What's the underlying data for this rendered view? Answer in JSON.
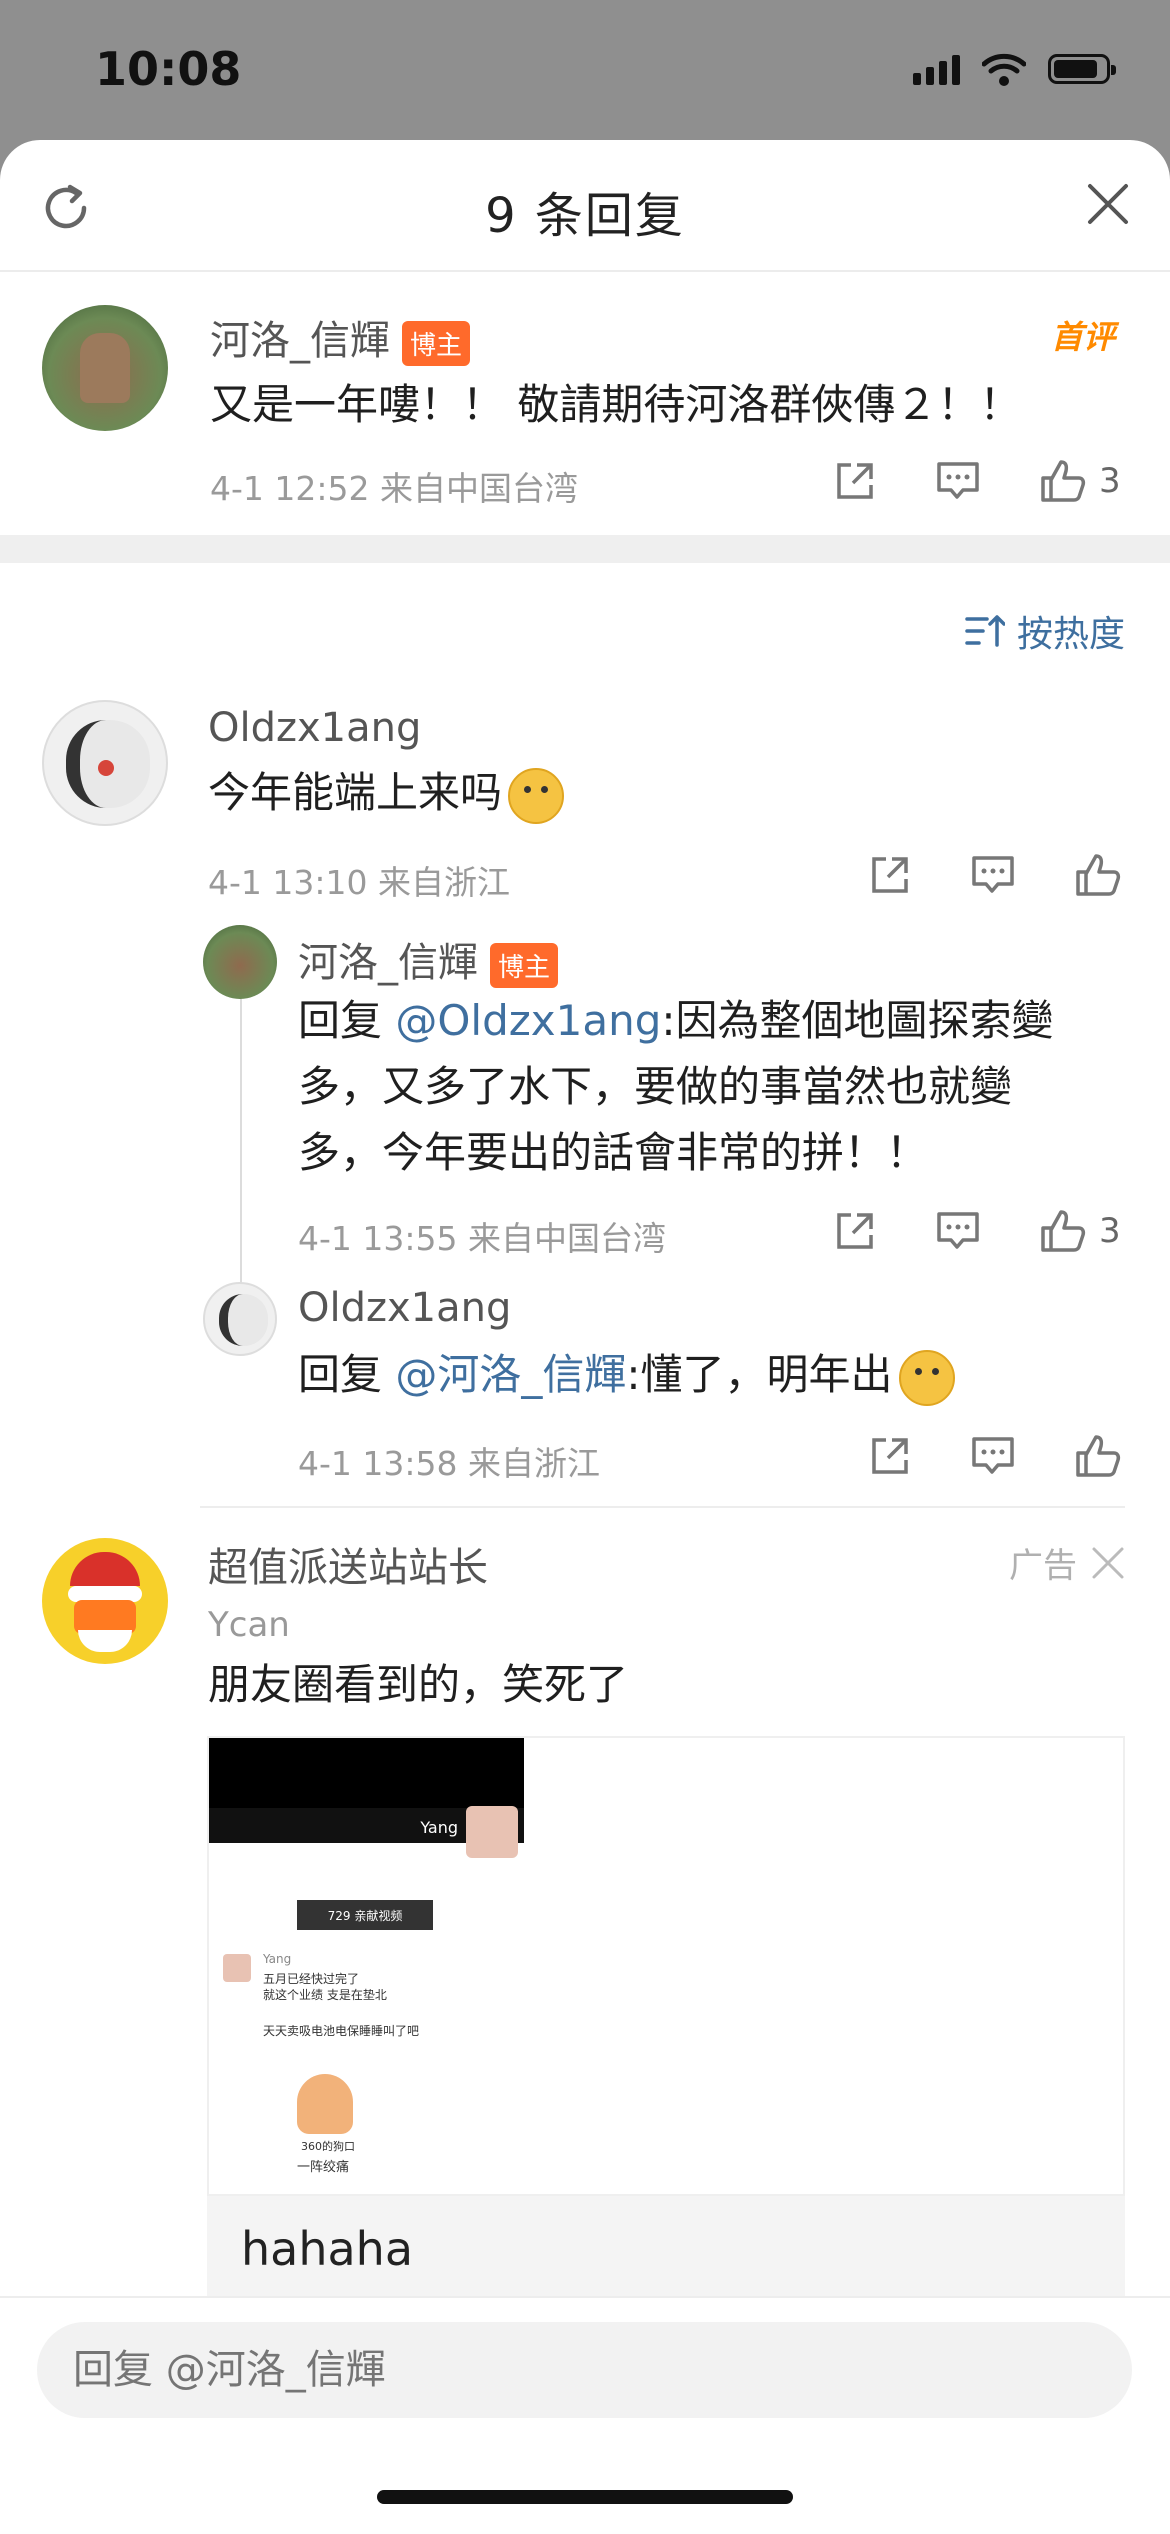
{
  "status": {
    "time": "10:08",
    "battery_level": 0.85
  },
  "header": {
    "title": "9 条回复"
  },
  "main_comment": {
    "author": "河洛_信輝",
    "badge": "博主",
    "tag": "首评",
    "text": "又是一年嘍！！ 敬請期待河洛群俠傳２！！",
    "meta": "4-1 12:52  来自中国台湾",
    "likes": "3"
  },
  "sort": {
    "label": "按热度"
  },
  "comments": [
    {
      "author": "Oldzx1ang",
      "text": "今年能端上来吗",
      "meta": "4-1 13:10  来自浙江",
      "replies": [
        {
          "author": "河洛_信輝",
          "badge": "博主",
          "prefix": "回复 ",
          "mention": "@Oldzx1ang",
          "text_line1": ":因為整個地圖探索變",
          "text_line2": "多，又多了水下，要做的事當然也就變",
          "text_line3": "多，今年要出的話會非常的拼！！",
          "meta": "4-1 13:55  来自中国台湾",
          "likes": "3"
        },
        {
          "author": "Oldzx1ang",
          "prefix": "回复 ",
          "mention": "@河洛_信輝",
          "text": ":懂了，明年出",
          "meta": "4-1 13:58  来自浙江"
        }
      ]
    }
  ],
  "ad": {
    "author": "超值派送站站长",
    "tag": "广告",
    "sub_author": "Ycan",
    "text": "朋友圈看到的，笑死了",
    "image_texts": {
      "video_name": "Yang",
      "pill": "729 亲献视频",
      "chat_name": "Yang",
      "chat_line1": "五月已经快过完了",
      "chat_line2": "就这个业绩 支是在垫北",
      "chat_line3": "天天卖吸电池电保睡睡叫了吧",
      "sticker_line1": "360的狗口",
      "sticker_line2": "一阵绞痛"
    },
    "caption": "hahaha"
  },
  "reply_bar": {
    "placeholder": "回复 @河洛_信輝"
  },
  "colors": {
    "accent": "#3f6f9f",
    "badge": "#ff6a2b",
    "tag": "#ff8a00"
  }
}
